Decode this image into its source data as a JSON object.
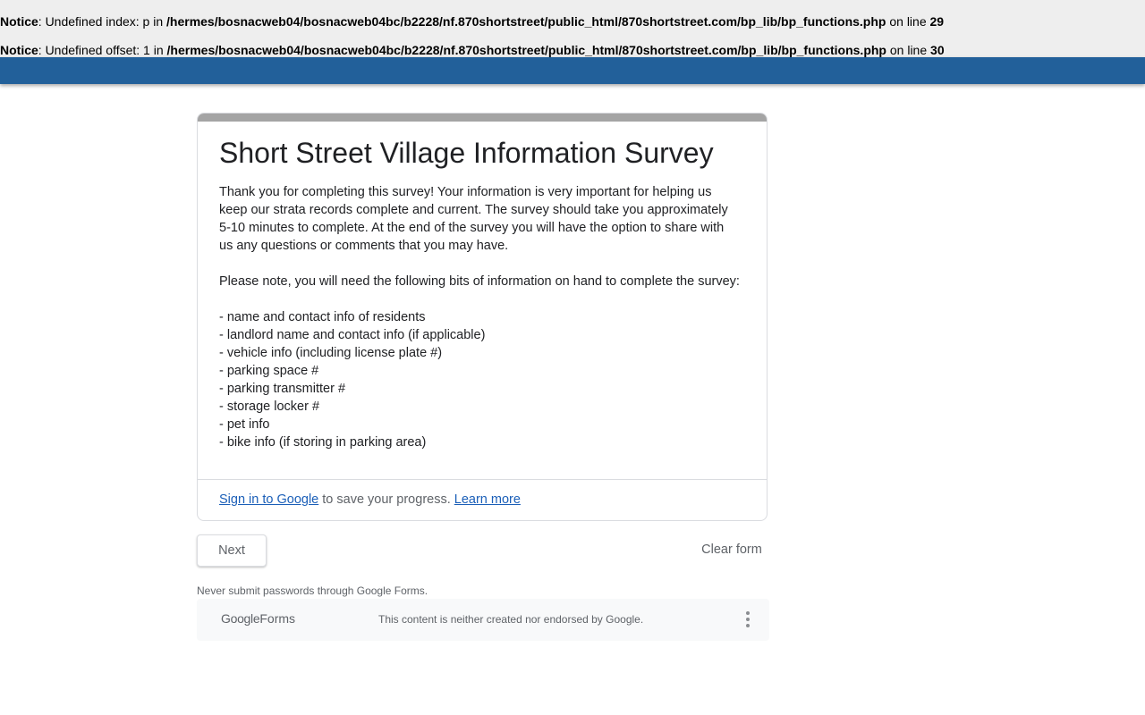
{
  "notices": [
    {
      "label": "Notice",
      "message": ": Undefined index: p in ",
      "path": "/hermes/bosnacweb04/bosnacweb04bc/b2228/nf.870shortstreet/public_html/870shortstreet.com/bp_lib/bp_functions.php",
      "on_line": " on line ",
      "line": "29"
    },
    {
      "label": "Notice",
      "message": ": Undefined offset: 1 in ",
      "path": "/hermes/bosnacweb04/bosnacweb04bc/b2228/nf.870shortstreet/public_html/870shortstreet.com/bp_lib/bp_functions.php",
      "on_line": " on line ",
      "line": "30"
    }
  ],
  "colors": {
    "header_bar": "#22609a",
    "card_top": "#a4a4a4",
    "link": "#1b5fb8"
  },
  "form": {
    "title": "Short Street Village Information Survey",
    "description": {
      "intro_lines": [
        "Thank you for completing this survey!  Your information is very important for helping us",
        "keep our strata records complete and current.  The survey should take you approximately",
        "5-10 minutes to complete.  At the end of the survey you will have the option to share with",
        "us any questions or comments that you may have."
      ],
      "note": "Please note, you will need the following bits of information on hand to complete the survey:",
      "items": [
        "- name and contact info of residents",
        "- landlord name and contact info (if applicable)",
        "- vehicle info (including license plate #)",
        "- parking space #",
        "- parking transmitter #",
        "- storage locker #",
        "- pet info",
        "- bike info (if storing in parking area)"
      ]
    },
    "signin": {
      "link": "Sign in to Google",
      "text": " to save your progress. ",
      "learn_more": "Learn more"
    },
    "next_label": "Next",
    "clear_label": "Clear form",
    "password_warning": "Never submit passwords through Google Forms."
  },
  "footer": {
    "logo_google": "Google",
    "logo_forms": "Forms",
    "disclaimer": "This content is neither created nor endorsed by Google.",
    "menu_icon": "more-vert-icon"
  }
}
